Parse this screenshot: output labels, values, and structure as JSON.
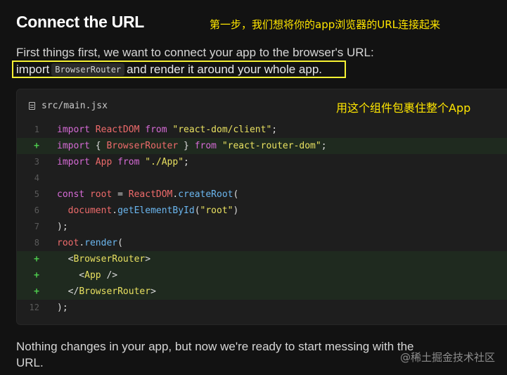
{
  "heading": "Connect the URL",
  "annotations": {
    "top": "第一步，我们想将你的app浏览器的URL连接起来",
    "code": "用这个组件包裹住整个App"
  },
  "intro": {
    "line1": "First things first, we want to connect your app to the browser's URL:",
    "line2_pre": "import",
    "line2_code": "BrowserRouter",
    "line2_post": "and render it around your whole app."
  },
  "code_block": {
    "filename": "src/main.jsx",
    "file_icon": "document-icon",
    "lines": [
      {
        "marker": "1",
        "added": false,
        "tokens": [
          [
            "k",
            "import "
          ],
          [
            "v",
            "ReactDOM "
          ],
          [
            "k",
            "from "
          ],
          [
            "s",
            "\"react-dom/client\""
          ],
          [
            "p",
            ";"
          ]
        ]
      },
      {
        "marker": "+",
        "added": true,
        "tokens": [
          [
            "k",
            "import "
          ],
          [
            "p",
            "{ "
          ],
          [
            "v",
            "BrowserRouter "
          ],
          [
            "p",
            "} "
          ],
          [
            "k",
            "from "
          ],
          [
            "s",
            "\"react-router-dom\""
          ],
          [
            "p",
            ";"
          ]
        ]
      },
      {
        "marker": "3",
        "added": false,
        "tokens": [
          [
            "k",
            "import "
          ],
          [
            "v",
            "App "
          ],
          [
            "k",
            "from "
          ],
          [
            "s",
            "\"./App\""
          ],
          [
            "p",
            ";"
          ]
        ]
      },
      {
        "marker": "4",
        "added": false,
        "tokens": []
      },
      {
        "marker": "5",
        "added": false,
        "tokens": [
          [
            "k",
            "const "
          ],
          [
            "v",
            "root "
          ],
          [
            "p",
            "= "
          ],
          [
            "v",
            "ReactDOM"
          ],
          [
            "p",
            "."
          ],
          [
            "f",
            "createRoot"
          ],
          [
            "p",
            "("
          ]
        ]
      },
      {
        "marker": "6",
        "added": false,
        "tokens": [
          [
            "p",
            "  "
          ],
          [
            "v",
            "document"
          ],
          [
            "p",
            "."
          ],
          [
            "f",
            "getElementById"
          ],
          [
            "p",
            "("
          ],
          [
            "s",
            "\"root\""
          ],
          [
            "p",
            ")"
          ]
        ]
      },
      {
        "marker": "7",
        "added": false,
        "tokens": [
          [
            "p",
            ");"
          ]
        ]
      },
      {
        "marker": "8",
        "added": false,
        "tokens": [
          [
            "v",
            "root"
          ],
          [
            "p",
            "."
          ],
          [
            "f",
            "render"
          ],
          [
            "p",
            "("
          ]
        ]
      },
      {
        "marker": "+",
        "added": true,
        "tokens": [
          [
            "p",
            "  <"
          ],
          [
            "y",
            "BrowserRouter"
          ],
          [
            "p",
            ">"
          ]
        ]
      },
      {
        "marker": "+",
        "added": true,
        "tokens": [
          [
            "p",
            "    <"
          ],
          [
            "y",
            "App"
          ],
          [
            "p",
            " />"
          ]
        ]
      },
      {
        "marker": "+",
        "added": true,
        "tokens": [
          [
            "p",
            "  </"
          ],
          [
            "y",
            "BrowserRouter"
          ],
          [
            "p",
            ">"
          ]
        ]
      },
      {
        "marker": "12",
        "added": false,
        "tokens": [
          [
            "p",
            ");"
          ]
        ]
      }
    ]
  },
  "outro": "Nothing changes in your app, but now we're ready to start messing with the URL.",
  "watermark": "@稀土掘金技术社区"
}
